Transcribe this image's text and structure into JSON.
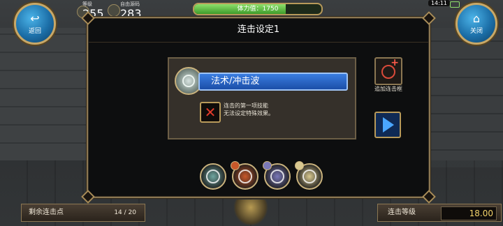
{
  "hud": {
    "back_label": "返回",
    "close_label": "关闭",
    "level_caption": "等级",
    "level_value": "255",
    "resource_caption": "自由源码",
    "resource_value": "283",
    "stamina_label": "体力值：1750",
    "stamina_fraction": 0.72,
    "clock": "14:11"
  },
  "dialog": {
    "title": "连击设定1",
    "skill_name": "法术/冲击波",
    "warning_line1": "连击的第一项技能",
    "warning_line2": "无法设定特殊效果。",
    "add_combo_label": "追加连击框"
  },
  "combo_icons": [
    {
      "name": "combo-skill-1-icon",
      "color": "#6fa6a0"
    },
    {
      "name": "combo-skill-2-icon",
      "color": "#c8582a"
    },
    {
      "name": "combo-skill-3-icon",
      "color": "#7a78b8"
    },
    {
      "name": "combo-skill-4-icon",
      "color": "#d8c890"
    }
  ],
  "footer": {
    "remaining_label": "剩余连击点",
    "remaining_value": "14 / 20",
    "combo_level_label": "连击等级",
    "combo_level_value": "18.00"
  }
}
